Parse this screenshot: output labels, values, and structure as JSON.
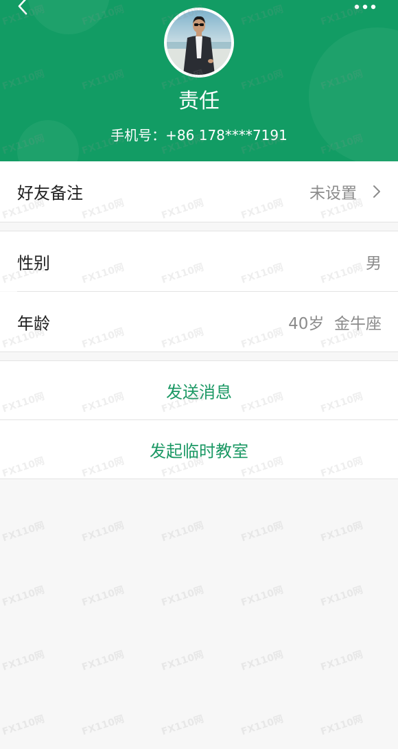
{
  "nav": {
    "back_icon": "chevron-left-icon",
    "more_icon": "more-dots-icon"
  },
  "header": {
    "name": "责任",
    "phone": "手机号：+86 178****7191"
  },
  "remark": {
    "label": "好友备注",
    "value": "未设置",
    "icon": "chevron-right-icon"
  },
  "info": [
    {
      "label": "性别",
      "value": "男"
    },
    {
      "label": "年龄",
      "value": "40岁  金牛座"
    }
  ],
  "actions": [
    {
      "label": "发送消息"
    },
    {
      "label": "发起临时教室"
    }
  ],
  "colors": {
    "header_bg": "#129c64",
    "action_text": "#1b9864",
    "page_bg": "#f7f7f7"
  },
  "watermark": "FX110网"
}
